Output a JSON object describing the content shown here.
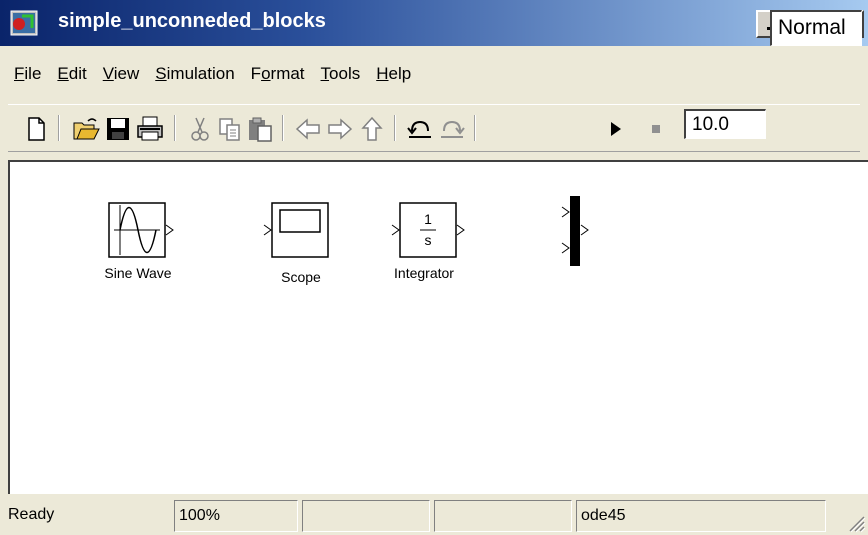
{
  "window": {
    "title": "simple_unconneded_blocks",
    "icon": "simulink-model-icon",
    "controls": [
      "minimize-icon",
      "maximize-icon",
      "close-icon"
    ]
  },
  "menu": [
    {
      "label": "File",
      "underline": "F",
      "rest": "ile"
    },
    {
      "label": "Edit",
      "underline": "E",
      "rest": "dit"
    },
    {
      "label": "View",
      "underline": "V",
      "rest": "iew"
    },
    {
      "label": "Simulation",
      "underline": "S",
      "rest": "imulation"
    },
    {
      "label": "Format",
      "pre": "F",
      "underline": "o",
      "rest": "rmat"
    },
    {
      "label": "Tools",
      "underline": "T",
      "rest": "ools"
    },
    {
      "label": "Help",
      "underline": "H",
      "rest": "elp"
    }
  ],
  "toolbar": {
    "icons": [
      "new-icon",
      "open-icon",
      "save-icon",
      "print-icon",
      "cut-icon",
      "copy-icon",
      "paste-icon",
      "back-icon",
      "forward-icon",
      "up-icon",
      "undo-icon",
      "redo-icon",
      "start-icon",
      "stop-icon"
    ],
    "stop_time": "10.0",
    "sim_mode": "Normal"
  },
  "blocks": {
    "sine_wave": {
      "label": "Sine Wave"
    },
    "scope": {
      "label": "Scope"
    },
    "integrator": {
      "label": "Integrator",
      "numerator": "1",
      "denominator": "s"
    },
    "mux": {
      "label": ""
    }
  },
  "status": {
    "state": "Ready",
    "zoom": "100%",
    "field3": "",
    "field4": "",
    "solver": "ode45"
  }
}
